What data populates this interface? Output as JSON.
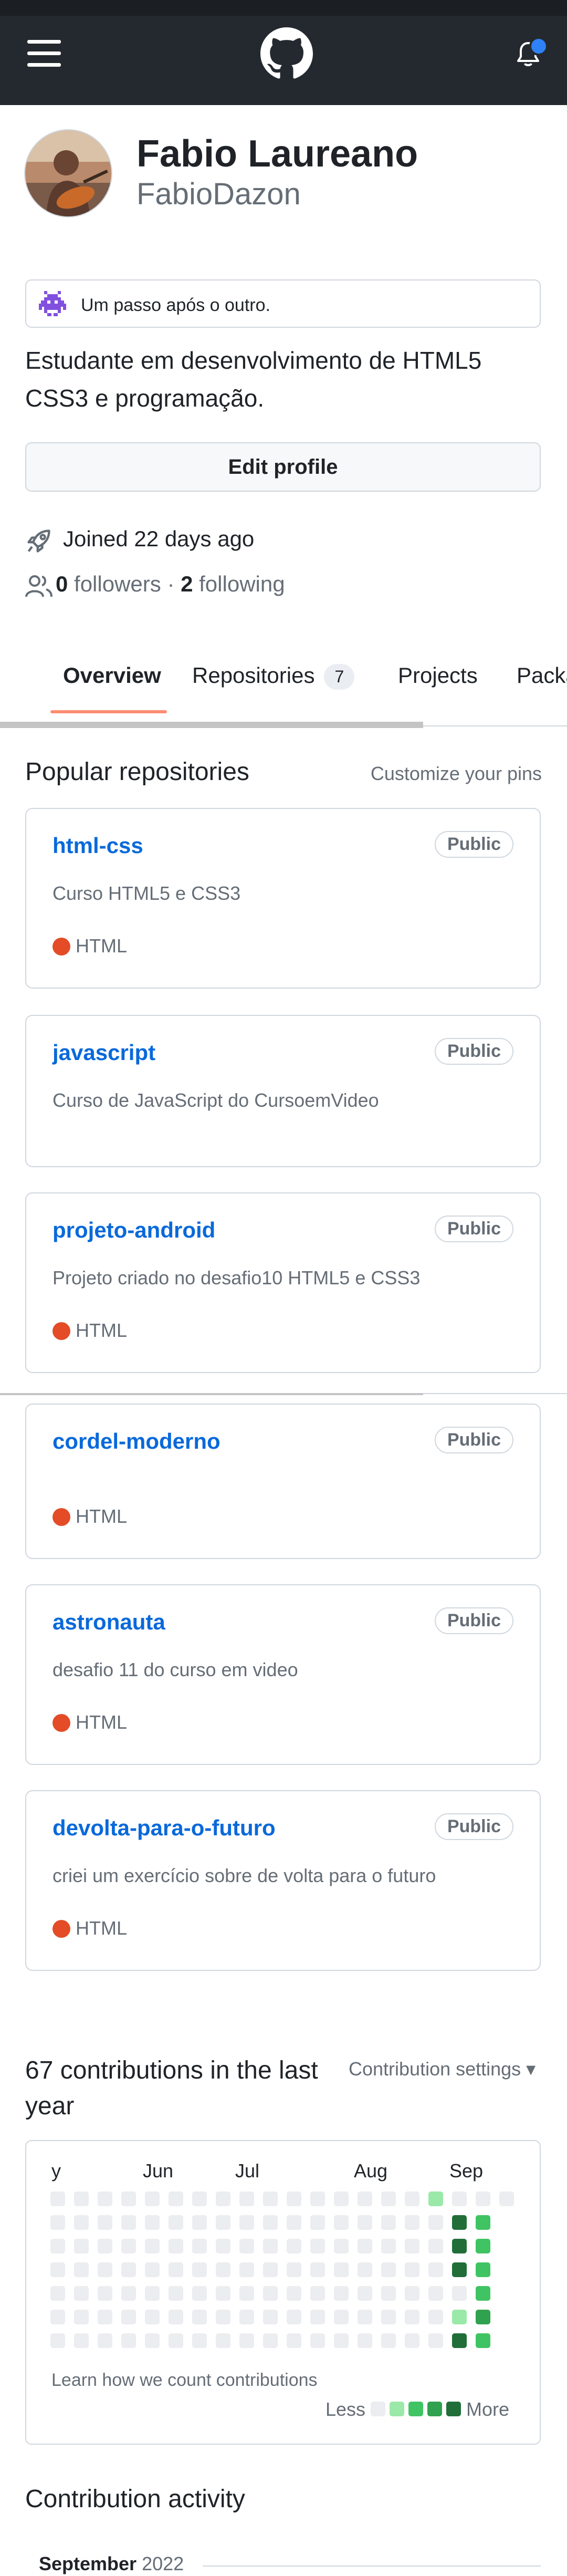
{
  "header": {
    "logo_icon": "github-octocat-icon",
    "menu_icon": "hamburger-menu-icon",
    "bell_icon": "bell-icon",
    "notification_dot_color": "#2f81f7"
  },
  "profile": {
    "name": "Fabio Laureano",
    "login": "FabioDazon",
    "status": "Um passo após o outro.",
    "bio": "Estudante em desenvolvimento de HTML5 CSS3 e programação.",
    "edit_button": "Edit profile",
    "joined": "Joined 22 days ago",
    "followers_count": "0",
    "followers_label": "followers",
    "dot": "·",
    "following_count": "2",
    "following_label": "following"
  },
  "tabs": [
    {
      "label": "Overview",
      "active": true
    },
    {
      "label": "Repositories",
      "counter": "7"
    },
    {
      "label": "Projects"
    },
    {
      "label": "Packa"
    }
  ],
  "popular": {
    "title": "Popular repositories",
    "customize": "Customize your pins",
    "repos": [
      {
        "name": "html-css",
        "visibility": "Public",
        "description": "Curso HTML5 e CSS3",
        "language": "HTML"
      },
      {
        "name": "javascript",
        "visibility": "Public",
        "description": "Curso de JavaScript do CursoemVideo",
        "language": ""
      },
      {
        "name": "projeto-android",
        "visibility": "Public",
        "description": "Projeto criado no desafio10 HTML5 e CSS3",
        "language": "HTML"
      },
      {
        "name": "cordel-moderno",
        "visibility": "Public",
        "description": "",
        "language": "HTML"
      },
      {
        "name": "astronauta",
        "visibility": "Public",
        "description": "desafio 11 do curso em video",
        "language": "HTML"
      },
      {
        "name": "devolta-para-o-futuro",
        "visibility": "Public",
        "description": "criei um exercício sobre de volta para o futuro",
        "language": "HTML"
      }
    ],
    "language_color": "#e34c26"
  },
  "contributions": {
    "title": "67 contributions in the last year",
    "settings": "Contribution settings ▾",
    "months": [
      "y",
      "Jun",
      "Jul",
      "Aug",
      "Sep"
    ],
    "learn": "Learn how we count contributions",
    "less": "Less",
    "more": "More",
    "level_colors": [
      "#ebedf0",
      "#9be9a8",
      "#40c463",
      "#30a14e",
      "#216e39"
    ]
  },
  "activity": {
    "title": "Contribution activity",
    "month": "September",
    "year": "2022"
  }
}
